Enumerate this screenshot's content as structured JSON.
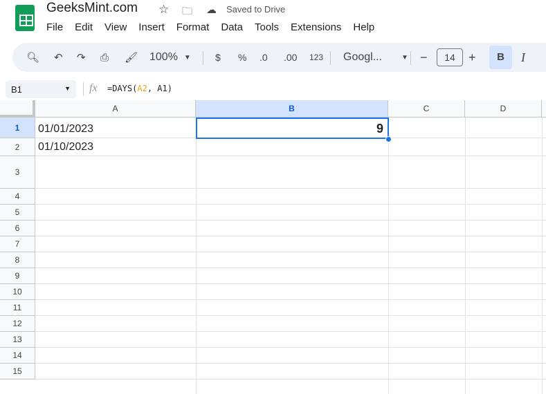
{
  "app": {
    "title": "GeeksMint.com",
    "status": "Saved to Drive"
  },
  "menu": [
    "File",
    "Edit",
    "View",
    "Insert",
    "Format",
    "Data",
    "Tools",
    "Extensions",
    "Help"
  ],
  "toolbar": {
    "zoom": "100%",
    "currency": "$",
    "percent": "%",
    "dec_decrease": ".0",
    "dec_increase": ".00",
    "number_format": "123",
    "font": "Googl...",
    "font_size": "14",
    "bold": "B",
    "italic": "I",
    "minus": "−",
    "plus": "+"
  },
  "formula_bar": {
    "name_box": "B1",
    "fx": "fx",
    "formula_prefix": "=DAYS(",
    "arg1": "A2",
    "sep": ", ",
    "arg2": "A1",
    "formula_suffix": ")",
    "arg1_color": "#e8a317"
  },
  "columns": [
    "A",
    "B",
    "C",
    "D"
  ],
  "rows": [
    "1",
    "2",
    "3",
    "4",
    "5",
    "6",
    "7",
    "8",
    "9",
    "10",
    "11",
    "12",
    "13",
    "14",
    "15"
  ],
  "cells": {
    "A1": "01/01/2023",
    "A2": "01/10/2023",
    "B1": "9"
  },
  "accent": "#1a73e8"
}
